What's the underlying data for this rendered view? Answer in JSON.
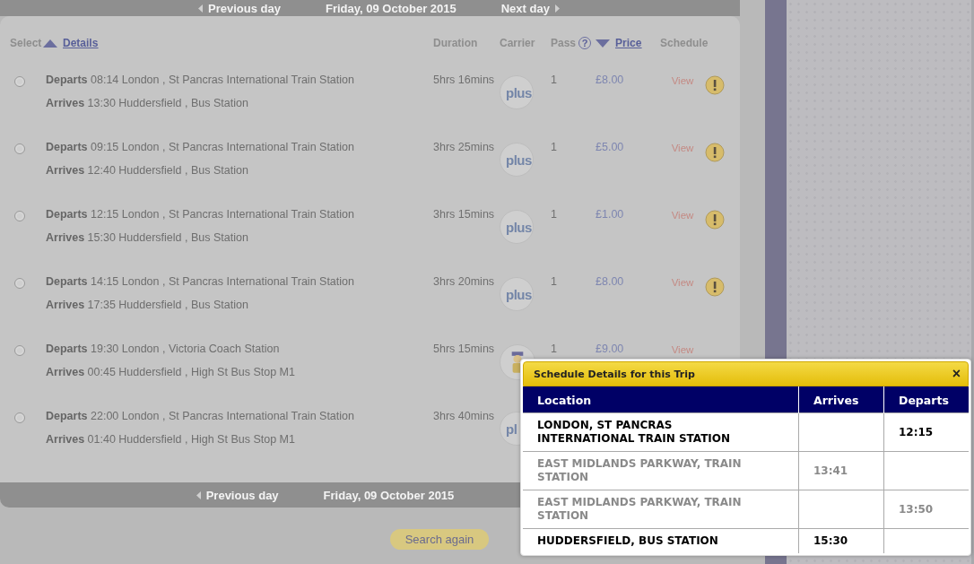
{
  "day_nav_top": {
    "previous": "Previous day",
    "date": "Friday, 09 October 2015",
    "next": "Next day"
  },
  "table": {
    "columns": [
      {
        "kind": "select",
        "label": "Select"
      },
      {
        "kind": "details",
        "label": "Details",
        "sorted_ascending": true
      },
      {
        "kind": "duration",
        "label": "Duration"
      },
      {
        "kind": "carrier",
        "label": "Carrier"
      },
      {
        "kind": "pass",
        "label": "Pass",
        "help": "?"
      },
      {
        "kind": "price",
        "label": "Price",
        "sorted_ascending": false
      },
      {
        "kind": "schedule",
        "label": "Schedule"
      }
    ],
    "rows": [
      {
        "selected": false,
        "departs_label": "Departs",
        "departs": "08:14 London , St Pancras International Train Station",
        "arrives_label": "Arrives",
        "arrives": "13:30 Huddersfield , Bus Station",
        "duration": "5hrs 16mins",
        "carrier": {
          "kind": "plus",
          "label": "plus"
        },
        "pass": "1",
        "price": "£8.00",
        "schedule": "View",
        "alert": true
      },
      {
        "selected": false,
        "departs_label": "Departs",
        "departs": "09:15 London , St Pancras International Train Station",
        "arrives_label": "Arrives",
        "arrives": "12:40 Huddersfield , Bus Station",
        "duration": "3hrs 25mins",
        "carrier": {
          "kind": "plus",
          "label": "plus"
        },
        "pass": "1",
        "price": "£5.00",
        "schedule": "View",
        "alert": true
      },
      {
        "selected": false,
        "departs_label": "Departs",
        "departs": "12:15 London , St Pancras International Train Station",
        "arrives_label": "Arrives",
        "arrives": "15:30 Huddersfield , Bus Station",
        "duration": "3hrs 15mins",
        "carrier": {
          "kind": "plus",
          "label": "plus"
        },
        "pass": "1",
        "price": "£1.00",
        "schedule": "View",
        "alert": true
      },
      {
        "selected": false,
        "departs_label": "Departs",
        "departs": "14:15 London , St Pancras International Train Station",
        "arrives_label": "Arrives",
        "arrives": "17:35 Huddersfield , Bus Station",
        "duration": "3hrs 20mins",
        "carrier": {
          "kind": "plus",
          "label": "plus"
        },
        "pass": "1",
        "price": "£8.00",
        "schedule": "View",
        "alert": true
      },
      {
        "selected": false,
        "departs_label": "Departs",
        "departs": "19:30 London , Victoria Coach Station",
        "arrives_label": "Arrives",
        "arrives": "00:45 Huddersfield , High St Bus Stop M1",
        "duration": "5hrs 15mins",
        "carrier": {
          "kind": "figure"
        },
        "pass": "1",
        "price": "£9.00",
        "schedule": "View"
      },
      {
        "selected": false,
        "departs_label": "Departs",
        "departs": "22:00 London , St Pancras International Train Station",
        "arrives_label": "Arrives",
        "arrives": "01:40 Huddersfield , High St Bus Stop M1",
        "duration": "3hrs 40mins",
        "carrier": {
          "kind": "plus",
          "label": "pl"
        }
      }
    ]
  },
  "day_nav_bottom": {
    "previous": "Previous day",
    "date": "Friday, 09 October 2015"
  },
  "actions": [
    {
      "label": "Search again"
    }
  ],
  "schedule_popup": {
    "title": "Schedule Details for this Trip",
    "close": "×",
    "columns": [
      "Location",
      "Arrives",
      "Departs"
    ],
    "stops": [
      {
        "kind": "endpoint",
        "location": "LONDON, ST PANCRAS INTERNATIONAL TRAIN STATION",
        "departs": "12:15"
      },
      {
        "kind": "intermediate",
        "location": "EAST MIDLANDS PARKWAY, TRAIN STATION",
        "arrives": "13:41"
      },
      {
        "kind": "intermediate",
        "location": "EAST MIDLANDS PARKWAY, TRAIN STATION",
        "departs": "13:50"
      },
      {
        "kind": "endpoint",
        "location": "HUDDERSFIELD, BUS STATION",
        "arrives": "15:30"
      }
    ]
  }
}
